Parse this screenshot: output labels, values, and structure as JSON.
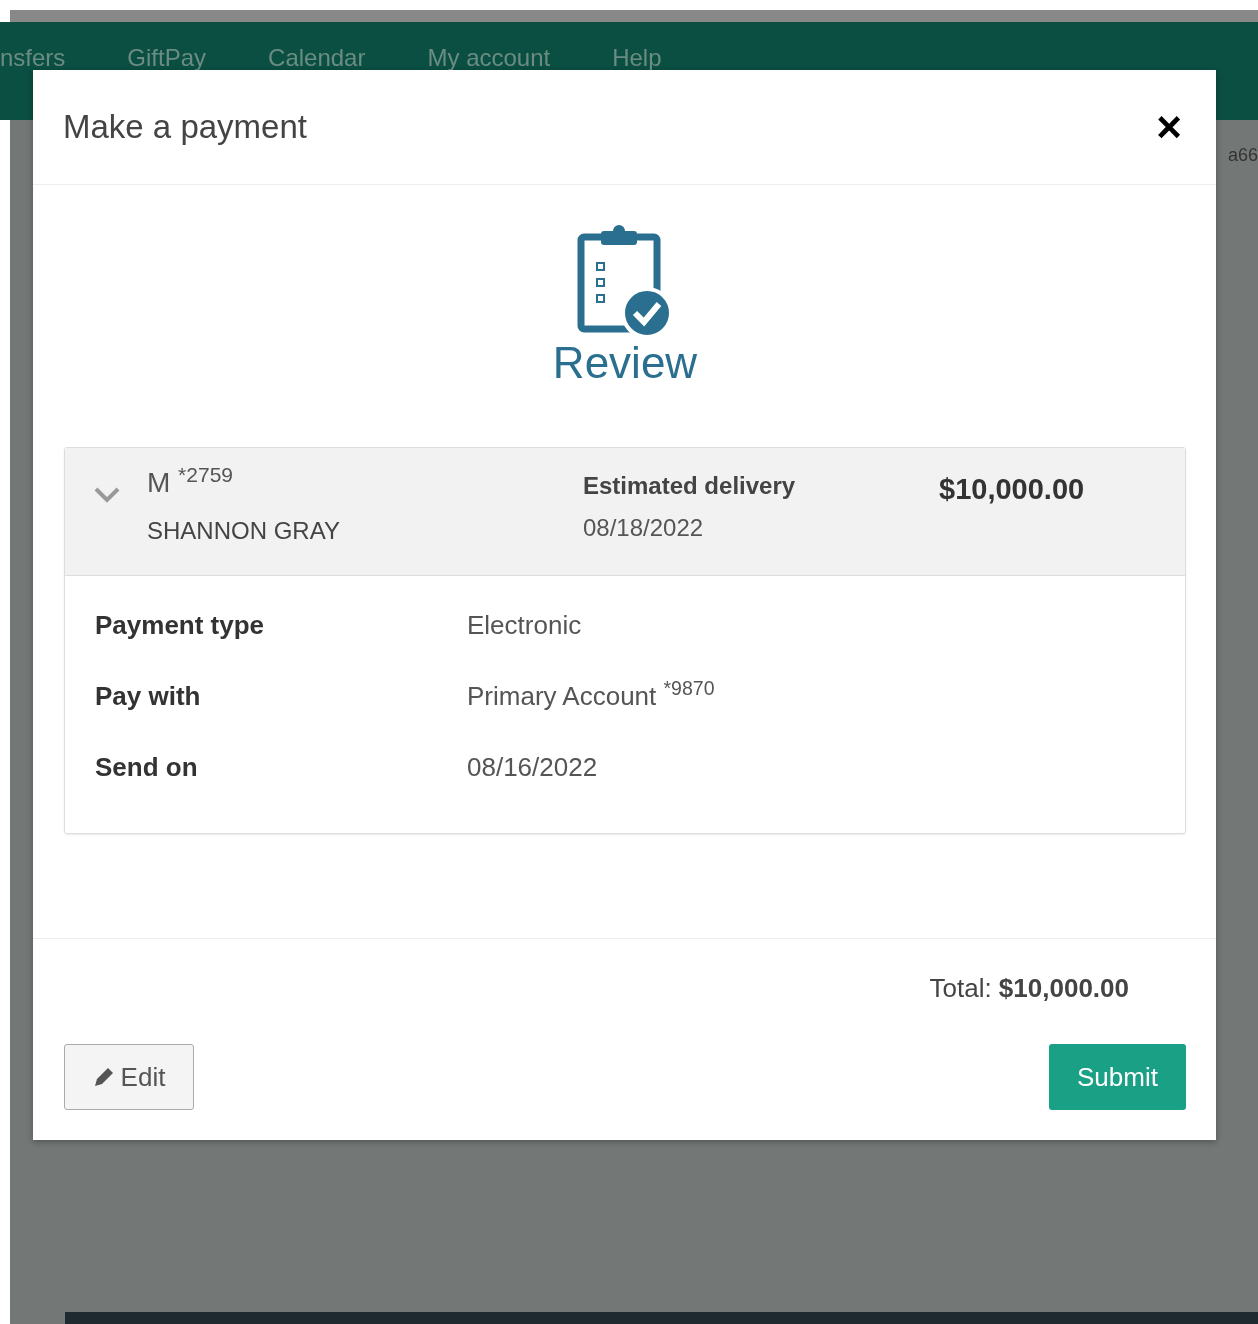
{
  "nav": {
    "items": [
      "nsfers",
      "GiftPay",
      "Calendar",
      "My account",
      "Help"
    ]
  },
  "background_text": "a66",
  "modal": {
    "title": "Make a payment",
    "close": "×",
    "step": {
      "label": "Review"
    },
    "payment": {
      "expanded": true,
      "payee": "M $^{*2759}$",
      "payee_name": "SHANNON GRAY",
      "delivery_label": "Estimated delivery",
      "delivery_date": "08/18/2022",
      "amount": "$10,000.00",
      "details": [
        {
          "label": "Payment type",
          "value": "Electronic"
        },
        {
          "label": "Pay with",
          "value": "Primary Account $^{*9870}$"
        },
        {
          "label": "Send on",
          "value": "08/16/2022"
        }
      ]
    },
    "total": "Total: **$10,000.00**",
    "buttons": [
      {
        "kind": "edit",
        "label": "Edit"
      },
      {
        "kind": "submit",
        "label": "Submit"
      }
    ]
  }
}
